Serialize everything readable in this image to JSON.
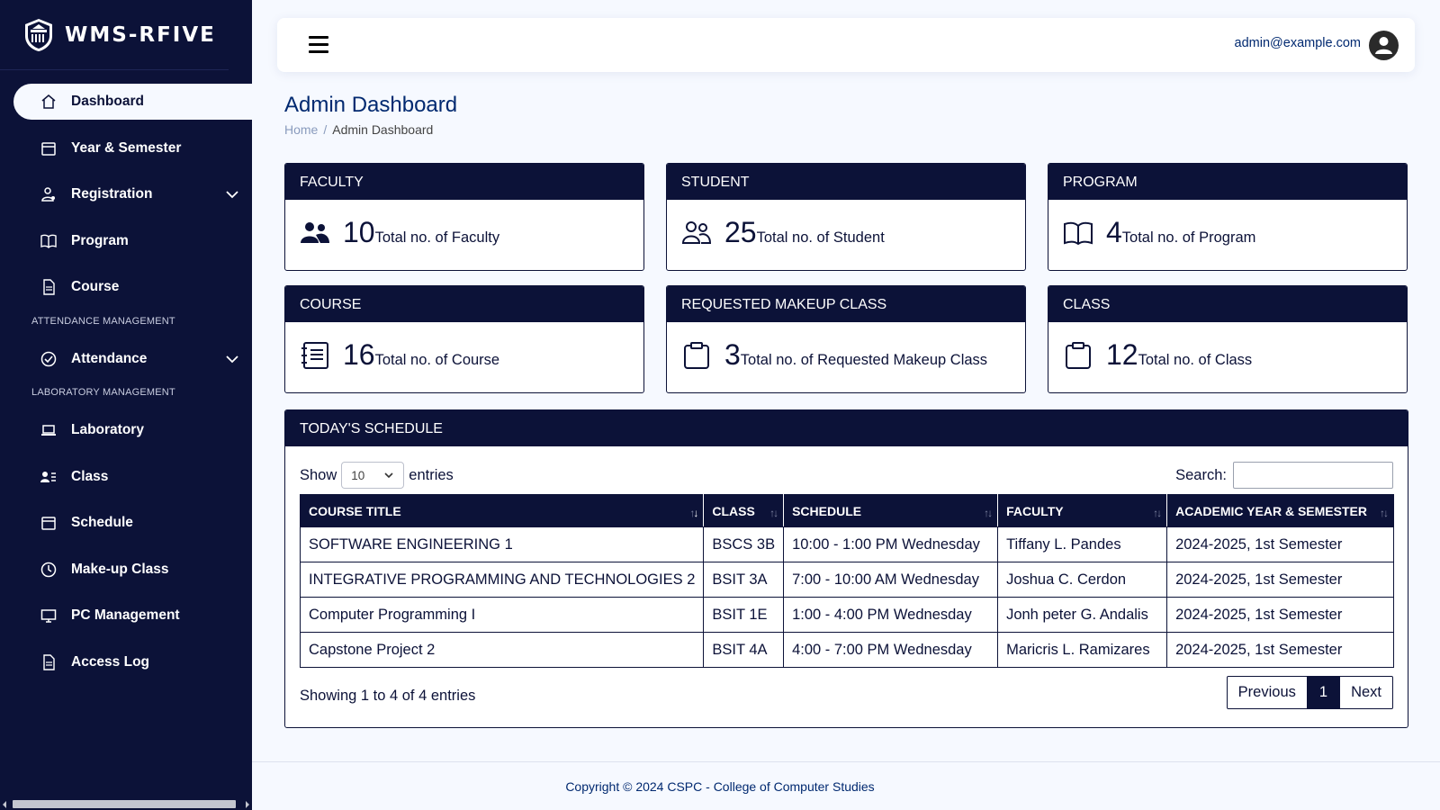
{
  "app": {
    "name": "WMS-RFIVE"
  },
  "sidebar": {
    "items": [
      {
        "label": "Dashboard"
      },
      {
        "label": "Year & Semester"
      },
      {
        "label": "Registration"
      },
      {
        "label": "Program"
      },
      {
        "label": "Course"
      },
      {
        "label": "Attendance"
      },
      {
        "label": "Laboratory"
      },
      {
        "label": "Class"
      },
      {
        "label": "Schedule"
      },
      {
        "label": "Make-up Class"
      },
      {
        "label": "PC Management"
      },
      {
        "label": "Access Log"
      }
    ],
    "headings": {
      "attendance": "ATTENDANCE MANAGEMENT",
      "laboratory": "LABORATORY MANAGEMENT"
    },
    "active": "Dashboard"
  },
  "header": {
    "user_email": "admin@example.com"
  },
  "page": {
    "title": "Admin Dashboard",
    "breadcrumb": {
      "home": "Home",
      "current": "Admin Dashboard"
    }
  },
  "cards": [
    {
      "title": "FACULTY",
      "value": "10",
      "label": "Total no. of Faculty",
      "icon": "people-fill-icon"
    },
    {
      "title": "STUDENT",
      "value": "25",
      "label": "Total no. of Student",
      "icon": "people-icon"
    },
    {
      "title": "PROGRAM",
      "value": "4",
      "label": "Total no. of Program",
      "icon": "book-icon"
    },
    {
      "title": "COURSE",
      "value": "16",
      "label": "Total no. of Course",
      "icon": "journal-text-icon"
    },
    {
      "title": "REQUESTED MAKEUP CLASS",
      "value": "3",
      "label": "Total no. of Requested Makeup Class",
      "icon": "clipboard-icon"
    },
    {
      "title": "CLASS",
      "value": "12",
      "label": "Total no. of Class",
      "icon": "clipboard-icon"
    }
  ],
  "schedule": {
    "title": "TODAY'S SCHEDULE",
    "show_label": "Show",
    "entries_value": "10",
    "entries_label": "entries",
    "search_label": "Search:",
    "search_value": "",
    "columns": [
      "COURSE TITLE",
      "CLASS",
      "SCHEDULE",
      "FACULTY",
      "ACADEMIC YEAR & SEMESTER"
    ],
    "rows": [
      [
        "SOFTWARE ENGINEERING 1",
        "BSCS 3B",
        "10:00 - 1:00 PM Wednesday",
        "Tiffany L. Pandes",
        "2024-2025, 1st Semester"
      ],
      [
        "INTEGRATIVE PROGRAMMING AND TECHNOLOGIES 2",
        "BSIT 3A",
        "7:00 - 10:00 AM Wednesday",
        "Joshua C. Cerdon",
        "2024-2025, 1st Semester"
      ],
      [
        "Computer Programming I",
        "BSIT 1E",
        "1:00 - 4:00 PM Wednesday",
        "Jonh peter G. Andalis",
        "2024-2025, 1st Semester"
      ],
      [
        "Capstone Project 2",
        "BSIT 4A",
        "4:00 - 7:00 PM Wednesday",
        "Maricris L. Ramizares",
        "2024-2025, 1st Semester"
      ]
    ],
    "info": "Showing 1 to 4 of 4 entries",
    "pagination": {
      "previous": "Previous",
      "current": "1",
      "next": "Next"
    }
  },
  "footer": {
    "text": "Copyright © 2024 CSPC - College of Computer Studies"
  },
  "colors": {
    "navy": "#0c1238",
    "text": "#012970",
    "background": "#f6f9ff"
  }
}
